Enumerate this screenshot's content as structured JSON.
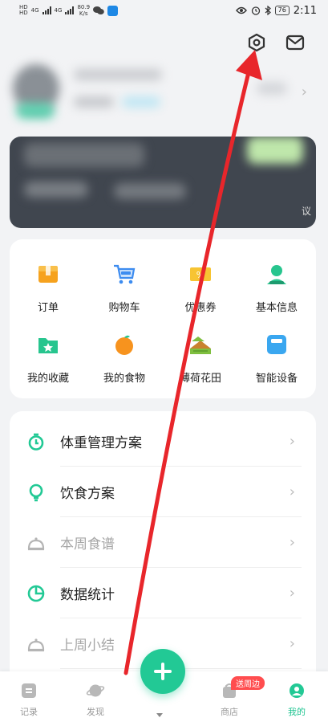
{
  "status_bar": {
    "network_a": "HD",
    "network_b": "4G",
    "speed_value": "80.9",
    "speed_unit": "K/s",
    "battery": "76",
    "time": "2:11"
  },
  "header": {
    "settings_icon": "hexagon-gear-icon",
    "message_icon": "envelope-icon"
  },
  "vip_card": {
    "edge_text": "议"
  },
  "shortcuts": [
    {
      "label": "订单",
      "icon": "order-box-icon",
      "color": "#f6a21e"
    },
    {
      "label": "购物车",
      "icon": "cart-icon",
      "color": "#3d8cf0"
    },
    {
      "label": "优惠券",
      "icon": "coupon-icon",
      "color": "#f7c432"
    },
    {
      "label": "基本信息",
      "icon": "user-icon",
      "color": "#27c58e"
    },
    {
      "label": "我的收藏",
      "icon": "folder-star-icon",
      "color": "#27c58e"
    },
    {
      "label": "我的食物",
      "icon": "orange-icon",
      "color": "#f7931e"
    },
    {
      "label": "薄荷花田",
      "icon": "farm-field-icon",
      "color": "#7fbf3f"
    },
    {
      "label": "智能设备",
      "icon": "smart-scale-icon",
      "color": "#3aa7f0"
    }
  ],
  "menu": [
    {
      "label": "体重管理方案",
      "icon": "stopwatch-icon",
      "muted": false
    },
    {
      "label": "饮食方案",
      "icon": "bulb-icon",
      "muted": false
    },
    {
      "label": "本周食谱",
      "icon": "food-cover-icon",
      "muted": true
    },
    {
      "label": "数据统计",
      "icon": "pie-chart-icon",
      "muted": false
    },
    {
      "label": "上周小结",
      "icon": "food-cover-icon",
      "muted": true
    }
  ],
  "tabbar": {
    "tabs": [
      {
        "label": "记录",
        "icon": "record-icon"
      },
      {
        "label": "发现",
        "icon": "planet-icon"
      },
      {
        "label": "商店",
        "icon": "shop-bag-icon"
      },
      {
        "label": "我的",
        "icon": "profile-icon"
      }
    ],
    "promo_badge": "送周边",
    "active_tab": "我的",
    "accent": "#22c995"
  }
}
